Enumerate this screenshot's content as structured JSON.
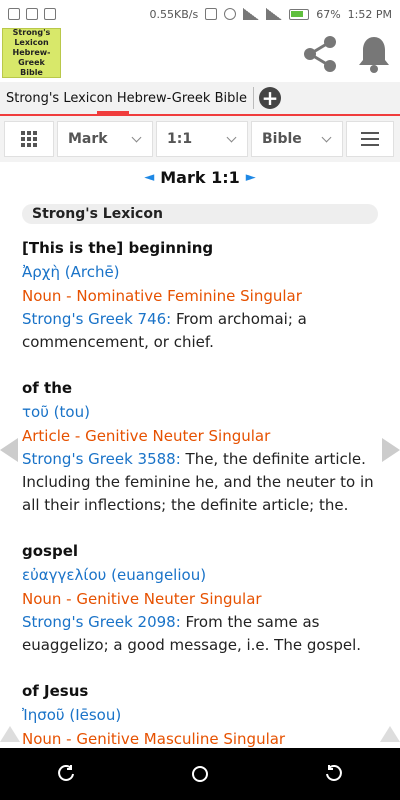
{
  "status_bar": {
    "speed": "0.55KB/s",
    "battery": "67%",
    "time": "1:52 PM"
  },
  "logo": {
    "lines": [
      "Strong's",
      "Lexicon",
      "Hebrew-Greek",
      "Bible"
    ]
  },
  "header": {
    "share_icon": "share-icon",
    "bell_icon": "bell-icon"
  },
  "tabs": {
    "active_label": "Strong's Lexicon Hebrew-Greek Bible",
    "add_label": "+"
  },
  "toolbar": {
    "book": "Mark",
    "chapter_verse": "1:1",
    "version": "Bible"
  },
  "verse_nav": {
    "prev": "◄",
    "title": "Mark 1:1",
    "next": "►"
  },
  "lexicon": {
    "header": "Strong's Lexicon",
    "entries": [
      {
        "english": "[This is the] beginning",
        "greek": "Ἀρχὴ",
        "translit": "(Archē)",
        "parse": "Noun - Nominative Feminine Singular",
        "ref": "Strong's Greek 746:",
        "definition_l1": " From archomai; a",
        "definition_l2": "commencement, or chief.",
        "definition_l3": ""
      },
      {
        "english": "of the",
        "greek": "τοῦ",
        "translit": "(tou)",
        "parse": "Article - Genitive Neuter Singular",
        "ref": "Strong's Greek 3588:",
        "definition_l1": " The, the definite article.",
        "definition_l2": "Including the feminine he, and the neuter to in",
        "definition_l3": "all their inflections; the definite article; the."
      },
      {
        "english": "gospel",
        "greek": "εὐαγγελίου",
        "translit": "(euangeliou)",
        "parse": "Noun - Genitive Neuter Singular",
        "ref": "Strong's Greek 2098:",
        "definition_l1": " From the same as",
        "definition_l2": "euaggelizo; a good message, i.e. The gospel.",
        "definition_l3": ""
      },
      {
        "english": "of Jesus",
        "greek": "Ἰησοῦ",
        "translit": "(Iēsou)",
        "parse": "Noun - Genitive Masculine Singular",
        "ref": "",
        "definition_l1": "",
        "definition_l2": "",
        "definition_l3": ""
      }
    ]
  },
  "colors": {
    "accent_red": "#f03c3c",
    "link_blue": "#1a73c8",
    "parse_orange": "#e65100"
  }
}
